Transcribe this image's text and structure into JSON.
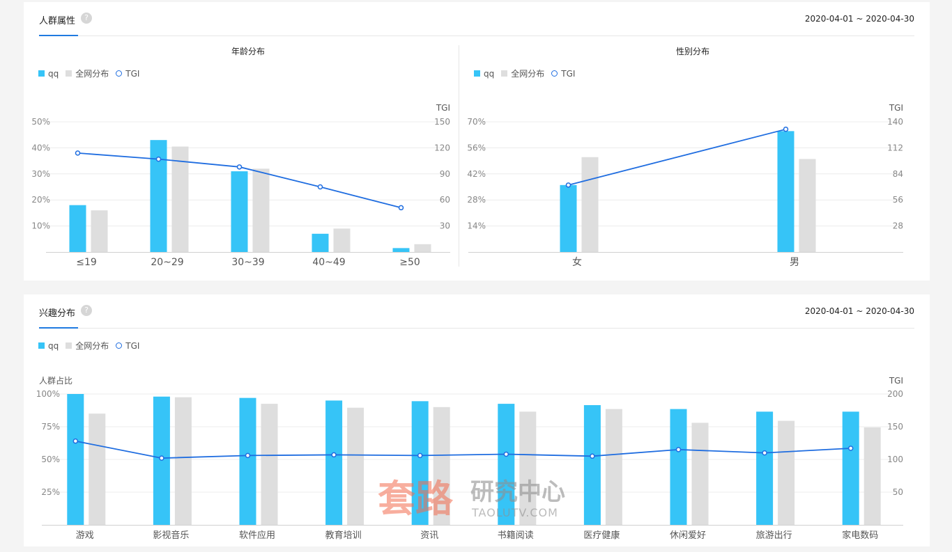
{
  "section1": {
    "title": "人群属性",
    "help": "?",
    "date_range": "2020-04-01 ~ 2020-04-30"
  },
  "section2": {
    "title": "兴趣分布",
    "help": "?",
    "date_range": "2020-04-01 ~ 2020-04-30"
  },
  "legend": {
    "qq": "qq",
    "all": "全网分布",
    "tgi": "TGI"
  },
  "colors": {
    "qq": "#36c4f7",
    "all": "#dedede",
    "tgi": "#1f6de0",
    "accent": "#1f7ae0"
  },
  "watermark": {
    "main": "套路",
    "side": "研究中心",
    "url": "TAOLUTV.COM"
  },
  "chart_data": [
    {
      "type": "bar",
      "title": "年龄分布",
      "categories": [
        "≤19",
        "20~29",
        "30~39",
        "40~49",
        "≥50"
      ],
      "series": [
        {
          "name": "qq",
          "values": [
            18,
            43,
            31,
            7,
            1.5
          ]
        },
        {
          "name": "全网分布",
          "values": [
            16,
            40.5,
            32,
            9,
            3
          ]
        }
      ],
      "line": {
        "name": "TGI",
        "values": [
          114,
          107,
          98,
          75,
          51
        ]
      },
      "ylim": [
        0,
        50
      ],
      "yticks": [
        10,
        20,
        30,
        40,
        50
      ],
      "ytick_labels": [
        "10%",
        "20%",
        "30%",
        "40%",
        "50%"
      ],
      "y2label": "TGI",
      "y2lim": [
        0,
        150
      ],
      "y2ticks": [
        30,
        60,
        90,
        120,
        150
      ],
      "y2tick_labels": [
        "30",
        "60",
        "90",
        "120",
        "150"
      ],
      "ylabel": ""
    },
    {
      "type": "bar",
      "title": "性别分布",
      "categories": [
        "女",
        "男"
      ],
      "series": [
        {
          "name": "qq",
          "values": [
            36,
            65
          ]
        },
        {
          "name": "全网分布",
          "values": [
            51,
            50
          ]
        }
      ],
      "line": {
        "name": "TGI",
        "values": [
          72,
          132
        ]
      },
      "ylim": [
        0,
        70
      ],
      "yticks": [
        14,
        28,
        42,
        56,
        70
      ],
      "ytick_labels": [
        "14%",
        "28%",
        "42%",
        "56%",
        "70%"
      ],
      "y2label": "TGI",
      "y2lim": [
        0,
        140
      ],
      "y2ticks": [
        28,
        56,
        84,
        112,
        140
      ],
      "y2tick_labels": [
        "28",
        "56",
        "84",
        "112",
        "140"
      ],
      "ylabel": ""
    },
    {
      "type": "bar",
      "title": "",
      "categories": [
        "游戏",
        "影视音乐",
        "软件应用",
        "教育培训",
        "资讯",
        "书籍阅读",
        "医疗健康",
        "休闲爱好",
        "旅游出行",
        "家电数码"
      ],
      "series": [
        {
          "name": "qq",
          "values": [
            100,
            98,
            97,
            95,
            94.5,
            92.5,
            91.5,
            88.5,
            86.5,
            86.5
          ]
        },
        {
          "name": "全网分布",
          "values": [
            85,
            97.5,
            92.5,
            89.5,
            90,
            86.5,
            88.5,
            78,
            79.5,
            74.5
          ]
        }
      ],
      "line": {
        "name": "TGI",
        "values": [
          128,
          102,
          106,
          107,
          106,
          108,
          105,
          115,
          110,
          117
        ]
      },
      "ylabel": "人群占比",
      "ylim": [
        0,
        100
      ],
      "yticks": [
        25,
        50,
        75,
        100
      ],
      "ytick_labels": [
        "25%",
        "50%",
        "75%",
        "100%"
      ],
      "y2label": "TGI",
      "y2lim": [
        0,
        200
      ],
      "y2ticks": [
        50,
        100,
        150,
        200
      ],
      "y2tick_labels": [
        "50",
        "100",
        "150",
        "200"
      ]
    }
  ]
}
